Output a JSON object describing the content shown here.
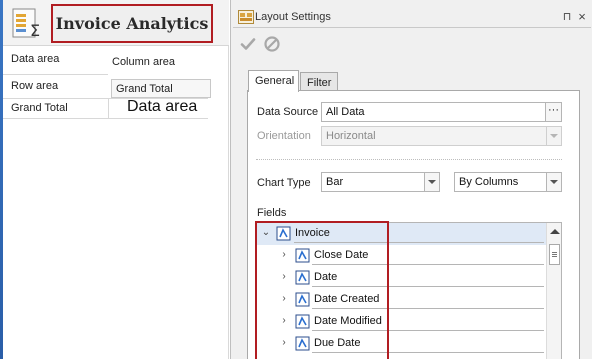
{
  "pivot": {
    "title": "Invoice Analytics",
    "data_area_label": "Data area",
    "column_area_label": "Column area",
    "row_area_label": "Row area",
    "grand_total_header": "Grand Total",
    "grand_total_row": "Grand Total",
    "data_area_value": "Data area"
  },
  "panel": {
    "title": "Layout Settings",
    "pin_glyph": "⊓",
    "close_glyph": "×",
    "toolbar": {
      "apply_icon": "check-icon",
      "cancel_icon": "cancel-icon"
    },
    "tabs": [
      {
        "label": "General",
        "active": true
      },
      {
        "label": "Filter",
        "active": false
      }
    ],
    "data_source": {
      "label": "Data Source",
      "value": "All Data",
      "button": "···"
    },
    "orientation": {
      "label": "Orientation",
      "value": "Horizontal",
      "disabled": true
    },
    "chart_type": {
      "label": "Chart Type",
      "value": "Bar",
      "series_by": "By Columns"
    },
    "fields": {
      "label": "Fields",
      "items": [
        {
          "label": "Invoice",
          "level": 0,
          "expanded": true,
          "selected": true
        },
        {
          "label": "Close Date",
          "level": 1,
          "expanded": false
        },
        {
          "label": "Date",
          "level": 1,
          "expanded": false
        },
        {
          "label": "Date Created",
          "level": 1,
          "expanded": false
        },
        {
          "label": "Date Modified",
          "level": 1,
          "expanded": false
        },
        {
          "label": "Due Date",
          "level": 1,
          "expanded": false
        }
      ]
    }
  },
  "colors": {
    "highlight": "#b11d22",
    "accent": "#3a76c4"
  }
}
